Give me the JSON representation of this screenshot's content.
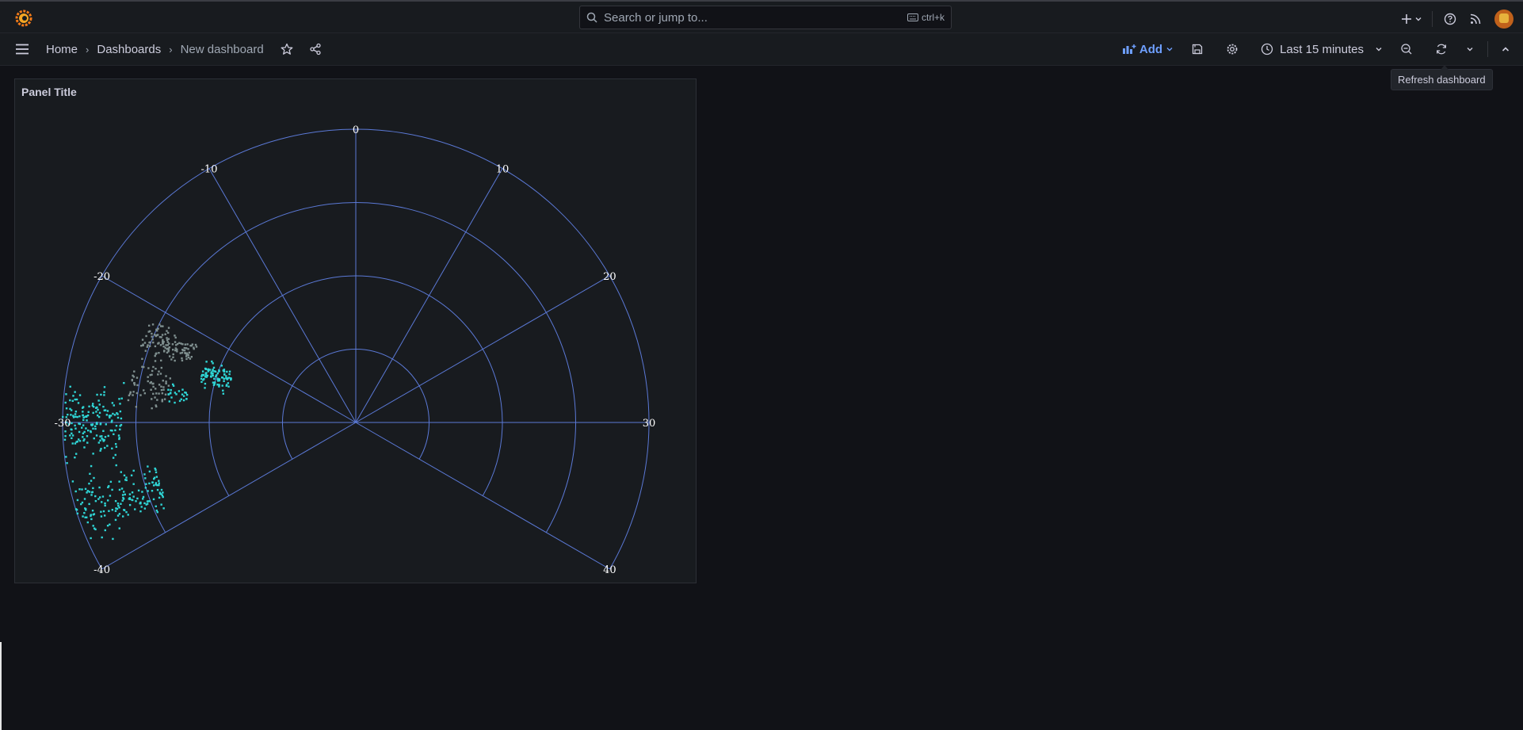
{
  "topbar": {
    "search_placeholder": "Search or jump to...",
    "search_shortcut": "ctrl+k",
    "icons": [
      "grafana-logo",
      "search-icon",
      "keyboard-icon",
      "plus-icon",
      "chevron-down-icon",
      "help-icon",
      "rss-icon",
      "avatar"
    ]
  },
  "navbar": {
    "breadcrumbs": [
      "Home",
      "Dashboards",
      "New dashboard"
    ],
    "add_label": "Add",
    "time_range": "Last 15 minutes"
  },
  "tooltip": "Refresh dashboard",
  "panel": {
    "title": "Panel Title"
  },
  "colors": {
    "background": "#111217",
    "panel": "#181b1f",
    "grid": "#5b79d6",
    "accent": "#6e9fff",
    "series_a": "#2fd6d6",
    "series_b": "#7f8f8f"
  },
  "chart_data": {
    "type": "scatter",
    "title": "",
    "angular_ticks": [
      "-40",
      "-30",
      "-20",
      "-10",
      "0",
      "10",
      "20",
      "30",
      "40"
    ],
    "angular_range": [
      -40,
      40
    ],
    "radial_rings": 4,
    "series": [
      {
        "color": "#2fd6d6",
        "clusters": [
          {
            "theta_center": -24,
            "theta_spread": 2.5,
            "r_min": 0.45,
            "r_max": 0.55,
            "count": 90
          },
          {
            "theta_center": -30,
            "theta_spread": 3.5,
            "r_min": 0.8,
            "r_max": 1.0,
            "count": 170
          },
          {
            "theta_center": -36,
            "theta_spread": 3.0,
            "r_min": 0.7,
            "r_max": 1.0,
            "count": 170
          },
          {
            "theta_center": -27,
            "theta_spread": 1.5,
            "r_min": 0.58,
            "r_max": 0.65,
            "count": 25
          }
        ]
      },
      {
        "color": "#7f8f8f",
        "clusters": [
          {
            "theta_center": -22.5,
            "theta_spread": 2.0,
            "r_min": 0.6,
            "r_max": 0.78,
            "count": 120
          },
          {
            "theta_center": -27,
            "theta_spread": 3.5,
            "r_min": 0.65,
            "r_max": 0.78,
            "count": 70
          }
        ]
      }
    ]
  }
}
